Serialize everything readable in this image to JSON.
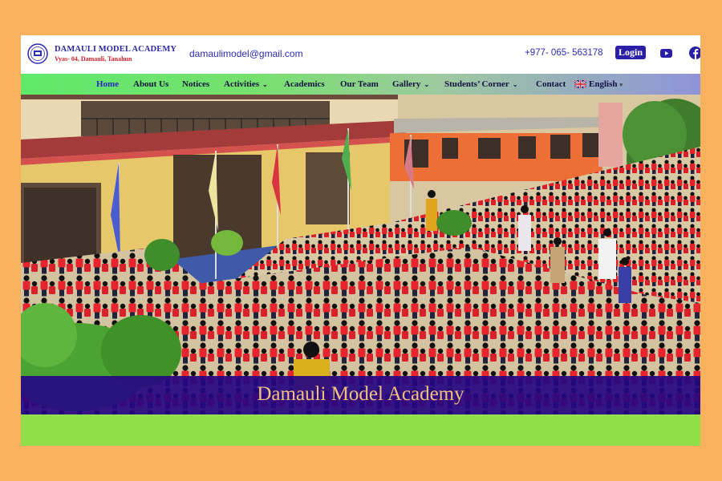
{
  "header": {
    "brand_name": "DAMAULI MODEL ACADEMY",
    "brand_address": "Vyas- 04, Damauli, Tanahun",
    "email": "damaulimodel@gmail.com",
    "phone": "+977- 065- 563178",
    "login_label": "Login",
    "social": [
      "youtube-icon",
      "facebook-icon"
    ]
  },
  "nav": {
    "items": [
      {
        "label": "Home",
        "active": true
      },
      {
        "label": "About Us"
      },
      {
        "label": "Notices"
      },
      {
        "label": "Activities",
        "dropdown": true
      },
      {
        "label": "Academics"
      },
      {
        "label": "Our Team"
      },
      {
        "label": "Gallery",
        "dropdown": true
      },
      {
        "label": "Students’ Corner",
        "dropdown": true
      },
      {
        "label": "Contact"
      }
    ],
    "language": "English"
  },
  "hero": {
    "caption": "Damauli Model Academy"
  },
  "colors": {
    "page_background": "#f9b15d",
    "brand_blue": "#2b1fa8",
    "caption_band": "#260682",
    "caption_text": "#f1c27c",
    "bottom_band": "#8fdf4a"
  }
}
